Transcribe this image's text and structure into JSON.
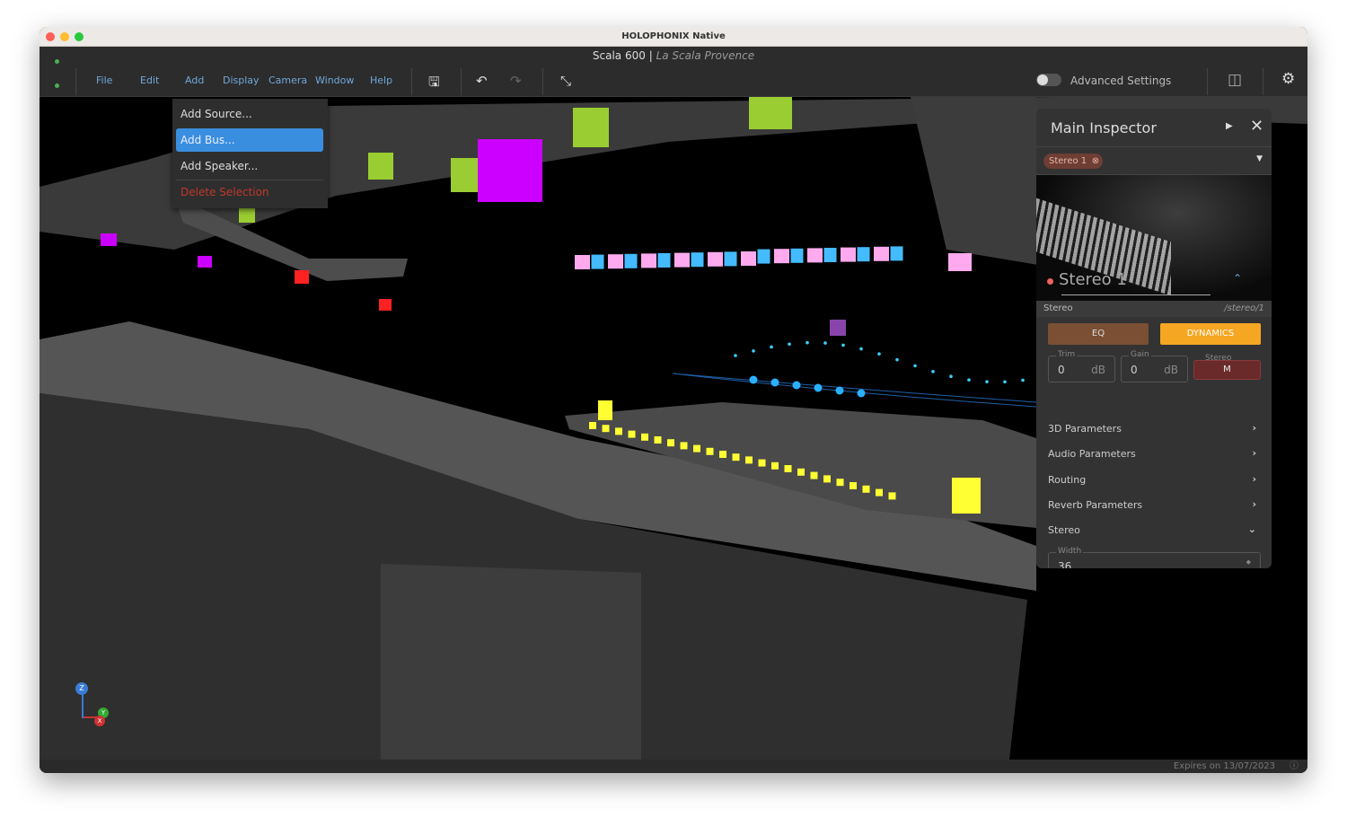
{
  "window": {
    "title": "HOLOPHONIX Native"
  },
  "header": {
    "project": "Scala 600",
    "separator": "|",
    "venue": "La Scala Provence",
    "menu": [
      "File",
      "Edit",
      "Add",
      "Display",
      "Camera",
      "Window",
      "Help"
    ],
    "advanced_settings": "Advanced Settings",
    "advanced_enabled": false
  },
  "add_menu": {
    "items": [
      "Add Source...",
      "Add Bus...",
      "Add Speaker...",
      "Delete Selection"
    ],
    "selected": "Add Bus..."
  },
  "inspector": {
    "title": "Main Inspector",
    "chip": "Stereo 1",
    "source_name": "Stereo 1",
    "type": "Stereo",
    "path": "/stereo/1",
    "eq_label": "EQ",
    "dynamics_label": "DYNAMICS",
    "trim": {
      "label": "Trim",
      "value": "0",
      "unit": "dB"
    },
    "gain": {
      "label": "Gain",
      "value": "0",
      "unit": "dB"
    },
    "stereo_mode": {
      "label": "Stereo",
      "value": "M"
    },
    "sections": [
      "3D Parameters",
      "Audio Parameters",
      "Routing",
      "Reverb Parameters",
      "Stereo"
    ],
    "width": {
      "label": "Width",
      "value": "36"
    }
  },
  "status": {
    "expires": "Expires on 13/07/2023"
  },
  "axes": {
    "z": "Z",
    "y": "Y",
    "x": "X"
  },
  "colors": {
    "accent": "#3a8ee0",
    "dynamics": "#f5a623",
    "speaker_green": "#9acd32",
    "speaker_yellow": "#ffff33",
    "bus_magenta": "#cc00ff",
    "pink": "#ffaaee",
    "cyan": "#44bbff",
    "red": "#ff2222"
  }
}
